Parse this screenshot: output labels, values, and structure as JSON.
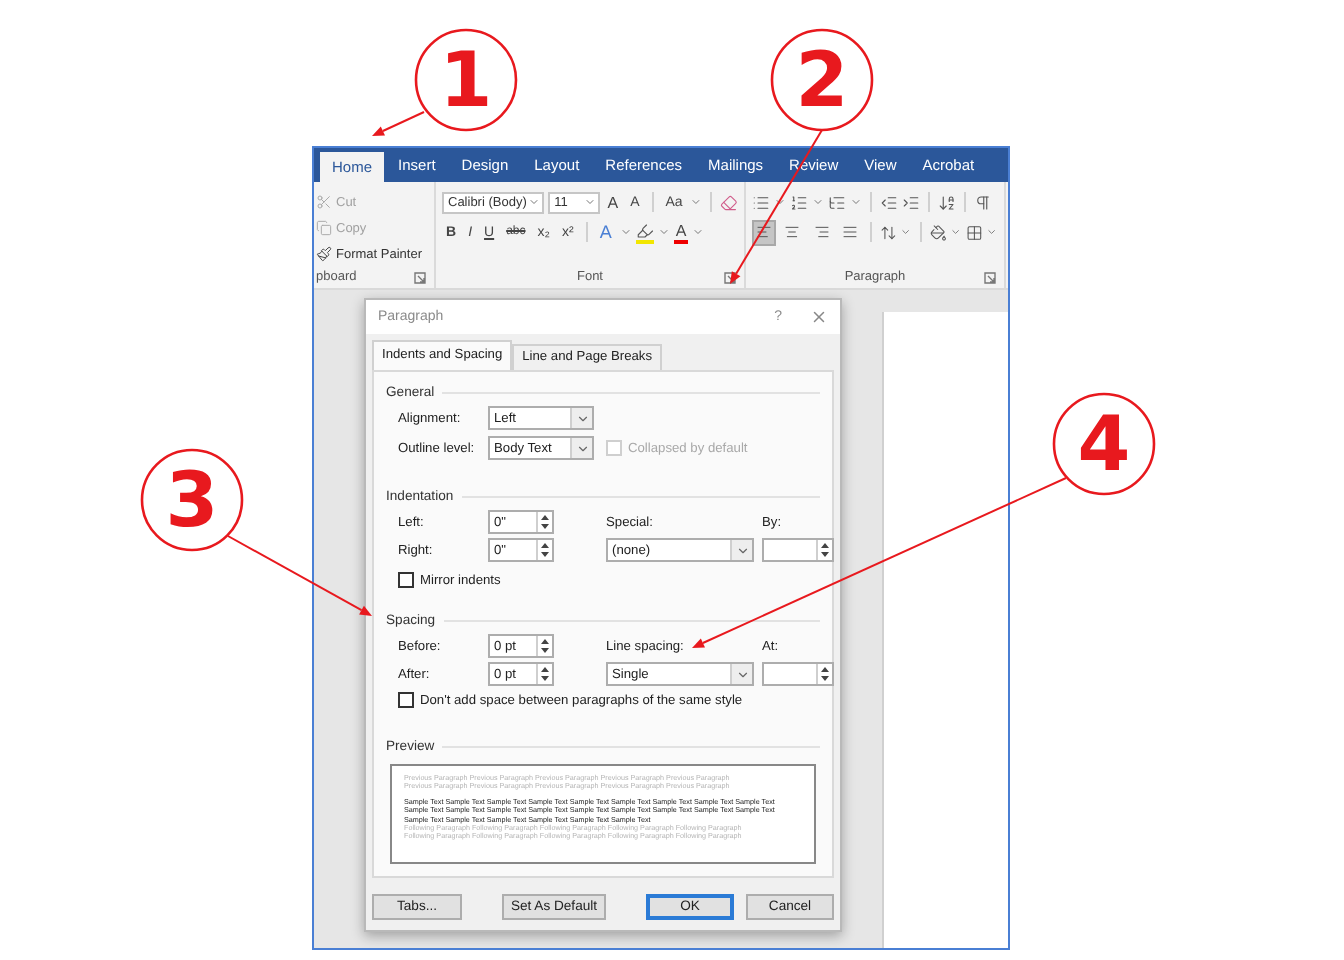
{
  "annotations": [
    {
      "number": "1"
    },
    {
      "number": "2"
    },
    {
      "number": "3"
    },
    {
      "number": "4"
    }
  ],
  "window": {
    "tabs": [
      {
        "label": "Home",
        "selected": true
      },
      {
        "label": "Insert",
        "selected": false
      },
      {
        "label": "Design",
        "selected": false
      },
      {
        "label": "Layout",
        "selected": false
      },
      {
        "label": "References",
        "selected": false
      },
      {
        "label": "Mailings",
        "selected": false
      },
      {
        "label": "Review",
        "selected": false
      },
      {
        "label": "View",
        "selected": false
      },
      {
        "label": "Acrobat",
        "selected": false
      }
    ],
    "ribbon": {
      "clipboard": {
        "items": [
          {
            "kind": "cut",
            "label": "Cut",
            "disabled": true
          },
          {
            "kind": "copy",
            "label": "Copy",
            "disabled": true
          },
          {
            "kind": "painter",
            "label": "Format Painter",
            "disabled": false
          }
        ],
        "group_label": "pboard"
      },
      "font": {
        "font_name": "Calibri (Body)",
        "font_size": "11",
        "size_buttons": [
          {
            "kind": "grow",
            "label": "A"
          },
          {
            "kind": "shrink",
            "label": "A"
          }
        ],
        "change_case": "Aa",
        "format_buttons": [
          {
            "kind": "bold",
            "label": "B"
          },
          {
            "kind": "italic",
            "label": "I"
          },
          {
            "kind": "underline",
            "label": "U"
          },
          {
            "kind": "strike",
            "label": "abc"
          },
          {
            "kind": "sub",
            "label": "x₂"
          },
          {
            "kind": "sup",
            "label": "x²"
          }
        ],
        "effects": "A",
        "font_color": "A",
        "group_label": "Font"
      },
      "paragraph": {
        "alignment_buttons": [
          {
            "kind": "left",
            "selected": true
          },
          {
            "kind": "center",
            "selected": false
          },
          {
            "kind": "right",
            "selected": false
          },
          {
            "kind": "justify",
            "selected": false
          }
        ],
        "group_label": "Paragraph"
      }
    }
  },
  "dialog": {
    "title": "Paragraph",
    "help": "?",
    "tabs": [
      {
        "label": "Indents and Spacing",
        "selected": true
      },
      {
        "label": "Line and Page Breaks",
        "selected": false
      }
    ],
    "general": {
      "heading": "General",
      "alignment": {
        "label": "Alignment:",
        "value": "Left"
      },
      "outline_level": {
        "label": "Outline level:",
        "value": "Body Text"
      },
      "collapsed": {
        "label": "Collapsed by default",
        "checked": false,
        "disabled": true
      }
    },
    "indentation": {
      "heading": "Indentation",
      "left": {
        "label": "Left:",
        "value": "0\""
      },
      "right": {
        "label": "Right:",
        "value": "0\""
      },
      "special": {
        "label": "Special:",
        "value": "(none)"
      },
      "by": {
        "label": "By:"
      },
      "mirror": {
        "label": "Mirror indents",
        "checked": false
      }
    },
    "spacing": {
      "heading": "Spacing",
      "before": {
        "label": "Before:",
        "value": "0 pt"
      },
      "after": {
        "label": "After:",
        "value": "0 pt"
      },
      "line_spacing": {
        "label": "Line spacing:",
        "value": "Single"
      },
      "at": {
        "label": "At:"
      },
      "dont_add": {
        "label": "Don't add space between paragraphs of the same style",
        "checked": false
      }
    },
    "preview": {
      "heading": "Preview",
      "previous_lines": [
        "Previous Paragraph Previous Paragraph Previous Paragraph Previous Paragraph Previous Paragraph",
        "Previous Paragraph Previous Paragraph Previous Paragraph Previous Paragraph Previous Paragraph"
      ],
      "sample_lines": [
        "Sample Text Sample Text Sample Text Sample Text Sample Text Sample Text Sample Text Sample Text Sample Text",
        "Sample Text Sample Text Sample Text Sample Text Sample Text Sample Text Sample Text Sample Text Sample Text",
        "Sample Text Sample Text Sample Text Sample Text Sample Text Sample Text"
      ],
      "following_lines": [
        "Following Paragraph Following Paragraph Following Paragraph Following Paragraph Following Paragraph",
        "Following Paragraph Following Paragraph Following Paragraph Following Paragraph Following Paragraph"
      ]
    },
    "buttons": [
      {
        "label": "Tabs...",
        "default": false
      },
      {
        "label": "Set As Default",
        "default": false
      },
      {
        "label": "OK",
        "default": true
      },
      {
        "label": "Cancel",
        "default": false
      }
    ]
  }
}
